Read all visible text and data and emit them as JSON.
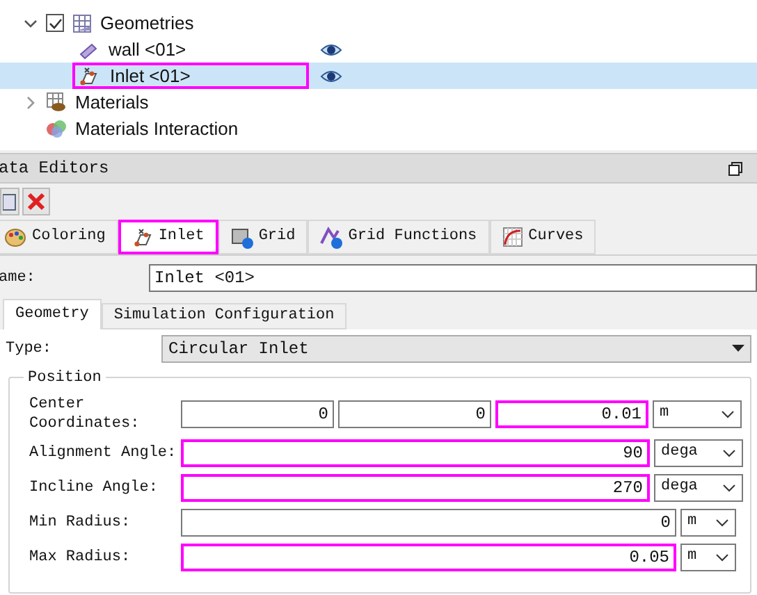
{
  "tree": [
    {
      "label": "Geometries",
      "expanded": true,
      "checked": true,
      "children": [
        {
          "label": "wall <01>",
          "visible": true,
          "selected": false,
          "highlighted": false
        },
        {
          "label": "Inlet <01>",
          "visible": true,
          "selected": true,
          "highlighted": true
        }
      ]
    },
    {
      "label": "Materials",
      "expanded": false
    },
    {
      "label": "Materials Interaction"
    }
  ],
  "panel": {
    "title": "ata Editors"
  },
  "tabs": [
    {
      "label": "Coloring",
      "selected": false,
      "highlighted": false
    },
    {
      "label": "Inlet",
      "selected": true,
      "highlighted": true
    },
    {
      "label": "Grid",
      "selected": false,
      "highlighted": false
    },
    {
      "label": "Grid Functions",
      "selected": false,
      "highlighted": false
    },
    {
      "label": "Curves",
      "selected": false,
      "highlighted": false
    }
  ],
  "name": {
    "label": "ame:",
    "value": "Inlet <01>"
  },
  "subtabs": [
    {
      "label": "Geometry",
      "selected": true
    },
    {
      "label": "Simulation Configuration",
      "selected": false
    }
  ],
  "type": {
    "label": "Type:",
    "value": "Circular Inlet"
  },
  "position": {
    "title": "Position",
    "rows": [
      {
        "label": "Center Coordinates:",
        "values": [
          {
            "value": "0",
            "highlighted": false
          },
          {
            "value": "0",
            "highlighted": false
          },
          {
            "value": "0.01",
            "highlighted": true
          }
        ],
        "unit": "m"
      },
      {
        "label": "Alignment Angle:",
        "values": [
          {
            "value": "90",
            "highlighted": true
          }
        ],
        "unit": "dega"
      },
      {
        "label": "Incline Angle:",
        "values": [
          {
            "value": "270",
            "highlighted": true
          }
        ],
        "unit": "dega"
      },
      {
        "label": "Min Radius:",
        "values": [
          {
            "value": "0",
            "highlighted": false
          }
        ],
        "unit": "m"
      },
      {
        "label": "Max Radius:",
        "values": [
          {
            "value": "0.05",
            "highlighted": true
          }
        ],
        "unit": "m"
      }
    ]
  }
}
